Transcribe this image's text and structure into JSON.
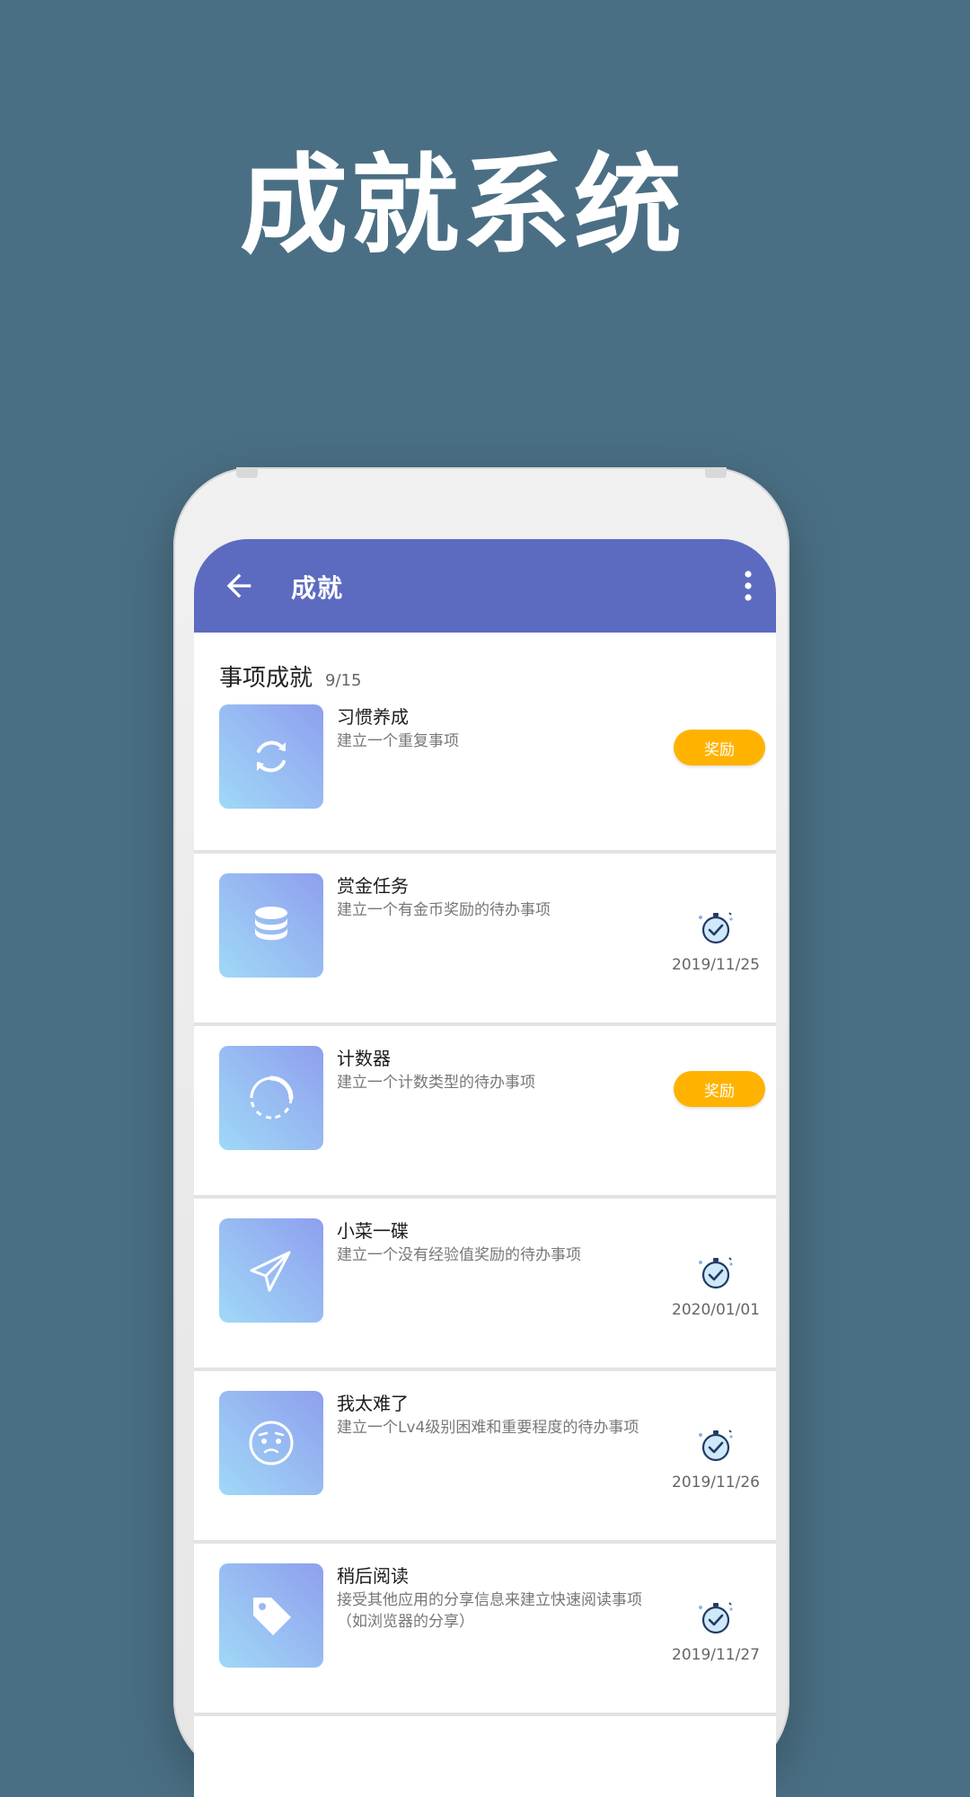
{
  "promo": {
    "title": "成就系统"
  },
  "appbar": {
    "title": "成就",
    "back_icon": "arrow-left-icon",
    "menu_icon": "more-vertical-icon"
  },
  "section": {
    "title": "事项成就",
    "count": "9/15"
  },
  "colors": {
    "appbar": "#5c6bc0",
    "reward": "#ffb300",
    "background": "#4a6f84"
  },
  "achievements": [
    {
      "name": "习惯养成",
      "desc": "建立一个重复事项",
      "icon": "repeat-icon",
      "status": "reward",
      "reward_label": "奖励"
    },
    {
      "name": "赏金任务",
      "desc": "建立一个有金币奖励的待办事项",
      "icon": "coins-stack-icon",
      "status": "done",
      "date": "2019/11/25"
    },
    {
      "name": "计数器",
      "desc": "建立一个计数类型的待办事项",
      "icon": "counter-ring-icon",
      "status": "reward",
      "reward_label": "奖励"
    },
    {
      "name": "小菜一碟",
      "desc": "建立一个没有经验值奖励的待办事项",
      "icon": "paper-plane-icon",
      "status": "done",
      "date": "2020/01/01"
    },
    {
      "name": "我太难了",
      "desc": "建立一个Lv4级别困难和重要程度的待办事项",
      "icon": "worried-face-icon",
      "status": "done",
      "date": "2019/11/26"
    },
    {
      "name": "稍后阅读",
      "desc": "接受其他应用的分享信息来建立快速阅读事项（如浏览器的分享）",
      "icon": "tag-icon",
      "status": "done",
      "date": "2019/11/27"
    }
  ]
}
